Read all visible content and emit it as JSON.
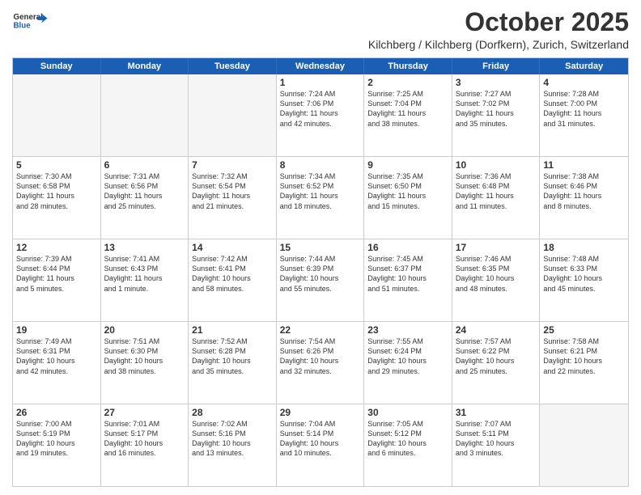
{
  "header": {
    "logo_general": "General",
    "logo_blue": "Blue",
    "month": "October 2025",
    "location": "Kilchberg / Kilchberg (Dorfkern), Zurich, Switzerland"
  },
  "calendar": {
    "days_of_week": [
      "Sunday",
      "Monday",
      "Tuesday",
      "Wednesday",
      "Thursday",
      "Friday",
      "Saturday"
    ],
    "rows": [
      [
        {
          "day": "",
          "info": "",
          "empty": true
        },
        {
          "day": "",
          "info": "",
          "empty": true
        },
        {
          "day": "",
          "info": "",
          "empty": true
        },
        {
          "day": "1",
          "info": "Sunrise: 7:24 AM\nSunset: 7:06 PM\nDaylight: 11 hours\nand 42 minutes.",
          "empty": false
        },
        {
          "day": "2",
          "info": "Sunrise: 7:25 AM\nSunset: 7:04 PM\nDaylight: 11 hours\nand 38 minutes.",
          "empty": false
        },
        {
          "day": "3",
          "info": "Sunrise: 7:27 AM\nSunset: 7:02 PM\nDaylight: 11 hours\nand 35 minutes.",
          "empty": false
        },
        {
          "day": "4",
          "info": "Sunrise: 7:28 AM\nSunset: 7:00 PM\nDaylight: 11 hours\nand 31 minutes.",
          "empty": false
        }
      ],
      [
        {
          "day": "5",
          "info": "Sunrise: 7:30 AM\nSunset: 6:58 PM\nDaylight: 11 hours\nand 28 minutes.",
          "empty": false
        },
        {
          "day": "6",
          "info": "Sunrise: 7:31 AM\nSunset: 6:56 PM\nDaylight: 11 hours\nand 25 minutes.",
          "empty": false
        },
        {
          "day": "7",
          "info": "Sunrise: 7:32 AM\nSunset: 6:54 PM\nDaylight: 11 hours\nand 21 minutes.",
          "empty": false
        },
        {
          "day": "8",
          "info": "Sunrise: 7:34 AM\nSunset: 6:52 PM\nDaylight: 11 hours\nand 18 minutes.",
          "empty": false
        },
        {
          "day": "9",
          "info": "Sunrise: 7:35 AM\nSunset: 6:50 PM\nDaylight: 11 hours\nand 15 minutes.",
          "empty": false
        },
        {
          "day": "10",
          "info": "Sunrise: 7:36 AM\nSunset: 6:48 PM\nDaylight: 11 hours\nand 11 minutes.",
          "empty": false
        },
        {
          "day": "11",
          "info": "Sunrise: 7:38 AM\nSunset: 6:46 PM\nDaylight: 11 hours\nand 8 minutes.",
          "empty": false
        }
      ],
      [
        {
          "day": "12",
          "info": "Sunrise: 7:39 AM\nSunset: 6:44 PM\nDaylight: 11 hours\nand 5 minutes.",
          "empty": false
        },
        {
          "day": "13",
          "info": "Sunrise: 7:41 AM\nSunset: 6:43 PM\nDaylight: 11 hours\nand 1 minute.",
          "empty": false
        },
        {
          "day": "14",
          "info": "Sunrise: 7:42 AM\nSunset: 6:41 PM\nDaylight: 10 hours\nand 58 minutes.",
          "empty": false
        },
        {
          "day": "15",
          "info": "Sunrise: 7:44 AM\nSunset: 6:39 PM\nDaylight: 10 hours\nand 55 minutes.",
          "empty": false
        },
        {
          "day": "16",
          "info": "Sunrise: 7:45 AM\nSunset: 6:37 PM\nDaylight: 10 hours\nand 51 minutes.",
          "empty": false
        },
        {
          "day": "17",
          "info": "Sunrise: 7:46 AM\nSunset: 6:35 PM\nDaylight: 10 hours\nand 48 minutes.",
          "empty": false
        },
        {
          "day": "18",
          "info": "Sunrise: 7:48 AM\nSunset: 6:33 PM\nDaylight: 10 hours\nand 45 minutes.",
          "empty": false
        }
      ],
      [
        {
          "day": "19",
          "info": "Sunrise: 7:49 AM\nSunset: 6:31 PM\nDaylight: 10 hours\nand 42 minutes.",
          "empty": false
        },
        {
          "day": "20",
          "info": "Sunrise: 7:51 AM\nSunset: 6:30 PM\nDaylight: 10 hours\nand 38 minutes.",
          "empty": false
        },
        {
          "day": "21",
          "info": "Sunrise: 7:52 AM\nSunset: 6:28 PM\nDaylight: 10 hours\nand 35 minutes.",
          "empty": false
        },
        {
          "day": "22",
          "info": "Sunrise: 7:54 AM\nSunset: 6:26 PM\nDaylight: 10 hours\nand 32 minutes.",
          "empty": false
        },
        {
          "day": "23",
          "info": "Sunrise: 7:55 AM\nSunset: 6:24 PM\nDaylight: 10 hours\nand 29 minutes.",
          "empty": false
        },
        {
          "day": "24",
          "info": "Sunrise: 7:57 AM\nSunset: 6:22 PM\nDaylight: 10 hours\nand 25 minutes.",
          "empty": false
        },
        {
          "day": "25",
          "info": "Sunrise: 7:58 AM\nSunset: 6:21 PM\nDaylight: 10 hours\nand 22 minutes.",
          "empty": false
        }
      ],
      [
        {
          "day": "26",
          "info": "Sunrise: 7:00 AM\nSunset: 5:19 PM\nDaylight: 10 hours\nand 19 minutes.",
          "empty": false
        },
        {
          "day": "27",
          "info": "Sunrise: 7:01 AM\nSunset: 5:17 PM\nDaylight: 10 hours\nand 16 minutes.",
          "empty": false
        },
        {
          "day": "28",
          "info": "Sunrise: 7:02 AM\nSunset: 5:16 PM\nDaylight: 10 hours\nand 13 minutes.",
          "empty": false
        },
        {
          "day": "29",
          "info": "Sunrise: 7:04 AM\nSunset: 5:14 PM\nDaylight: 10 hours\nand 10 minutes.",
          "empty": false
        },
        {
          "day": "30",
          "info": "Sunrise: 7:05 AM\nSunset: 5:12 PM\nDaylight: 10 hours\nand 6 minutes.",
          "empty": false
        },
        {
          "day": "31",
          "info": "Sunrise: 7:07 AM\nSunset: 5:11 PM\nDaylight: 10 hours\nand 3 minutes.",
          "empty": false
        },
        {
          "day": "",
          "info": "",
          "empty": true
        }
      ]
    ]
  }
}
